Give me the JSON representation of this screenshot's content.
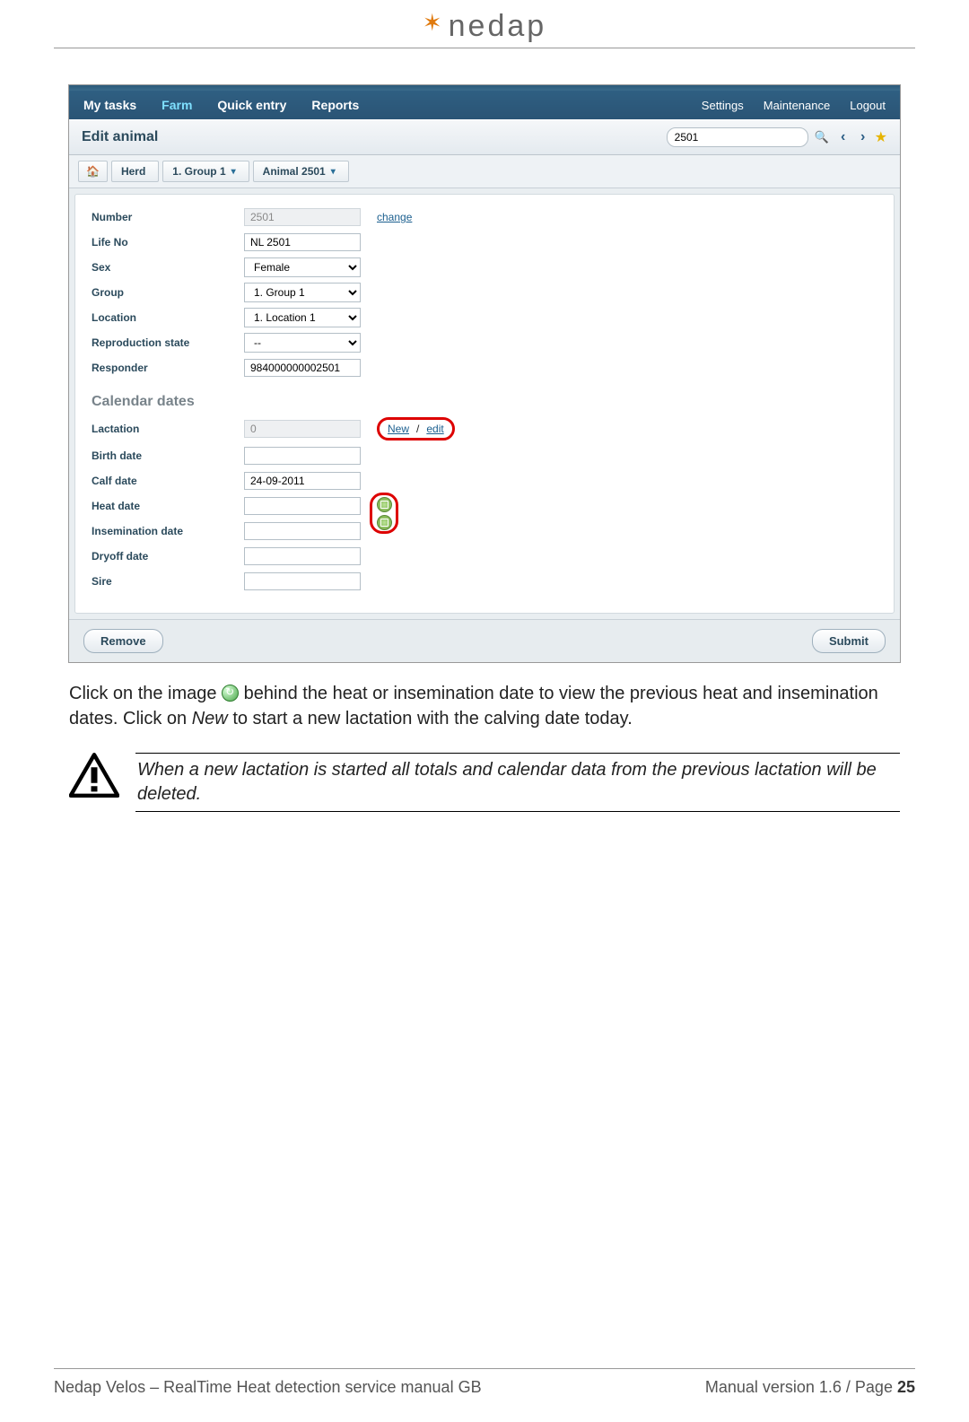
{
  "header": {
    "logo_text": "nedap"
  },
  "screenshot": {
    "nav_left": [
      "My tasks",
      "Farm",
      "Quick entry",
      "Reports"
    ],
    "nav_active_index": 1,
    "nav_right": [
      "Settings",
      "Maintenance",
      "Logout"
    ],
    "sub_title": "Edit animal",
    "search_value": "2501",
    "breadcrumbs": {
      "home": "⌂",
      "items": [
        "Herd",
        "1. Group 1",
        "Animal 2501"
      ]
    },
    "fields": {
      "number": {
        "label": "Number",
        "value": "2501",
        "link": "change"
      },
      "life_no": {
        "label": "Life No",
        "value": "NL 2501"
      },
      "sex": {
        "label": "Sex",
        "value": "Female"
      },
      "group": {
        "label": "Group",
        "value": "1. Group 1"
      },
      "location": {
        "label": "Location",
        "value": "1. Location 1"
      },
      "repro": {
        "label": "Reproduction state",
        "value": "--"
      },
      "responder": {
        "label": "Responder",
        "value": "984000000002501"
      }
    },
    "calendar_heading": "Calendar dates",
    "calendar": {
      "lactation": {
        "label": "Lactation",
        "value": "0",
        "link_new": "New",
        "sep": "/",
        "link_edit": "edit"
      },
      "birth": {
        "label": "Birth date",
        "value": ""
      },
      "calf": {
        "label": "Calf date",
        "value": "24-09-2011"
      },
      "heat": {
        "label": "Heat date",
        "value": ""
      },
      "insem": {
        "label": "Insemination date",
        "value": ""
      },
      "dryoff": {
        "label": "Dryoff date",
        "value": ""
      },
      "sire": {
        "label": "Sire",
        "value": ""
      }
    },
    "remove_label": "Remove",
    "submit_label": "Submit"
  },
  "body_text": {
    "p1a": "Click on the image ",
    "p1b": " behind the heat or insemination date to view the previous heat and insemination dates. Click on ",
    "p1_em": "New",
    "p1c": " to start a new lactation with the calving date today."
  },
  "warning": "When a new lactation is started all totals and calendar data from the previous lactation will be deleted.",
  "footer": {
    "left": "Nedap Velos – RealTime Heat detection service manual GB",
    "right_a": "Manual version 1.6 / Page ",
    "right_b": "25"
  }
}
